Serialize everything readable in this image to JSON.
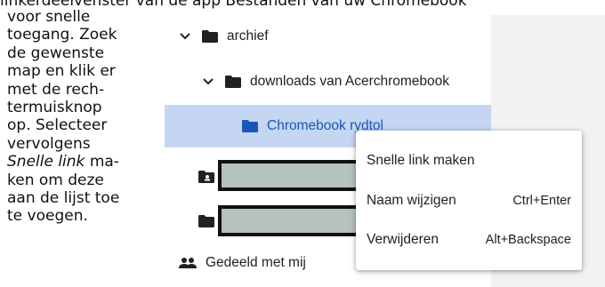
{
  "article": {
    "top_line": "linkerdeelvenster van de app Bestanden van uw Chromebook",
    "lines": [
      "voor snelle",
      "toegang. Zoek",
      "de gewenste",
      "map en klik er",
      "met de rech-",
      "termuisknop",
      "op. Selecteer",
      "vervolgens",
      "Snelle link",
      "ma-",
      "ken om deze",
      "aan de lijst toe",
      "te voegen."
    ]
  },
  "tree": {
    "archief": "archief",
    "downloads": "downloads van Acerchromebook",
    "selected_folder": "Chromebook rydtol",
    "shared": "Gedeeld met mij"
  },
  "context_menu": {
    "items": [
      {
        "label": "Snelle link maken",
        "shortcut": ""
      },
      {
        "label": "Naam wijzigen",
        "shortcut": "Ctrl+Enter"
      },
      {
        "label": "Verwijderen",
        "shortcut": "Alt+Backspace"
      }
    ]
  },
  "colors": {
    "selected_bg": "#c4d6f2",
    "selected_text": "#1a56b8",
    "redaction_fill": "#b5c2bd"
  },
  "icons": [
    "chevron-down-icon",
    "folder-icon",
    "shared-drive-icon",
    "people-icon"
  ]
}
